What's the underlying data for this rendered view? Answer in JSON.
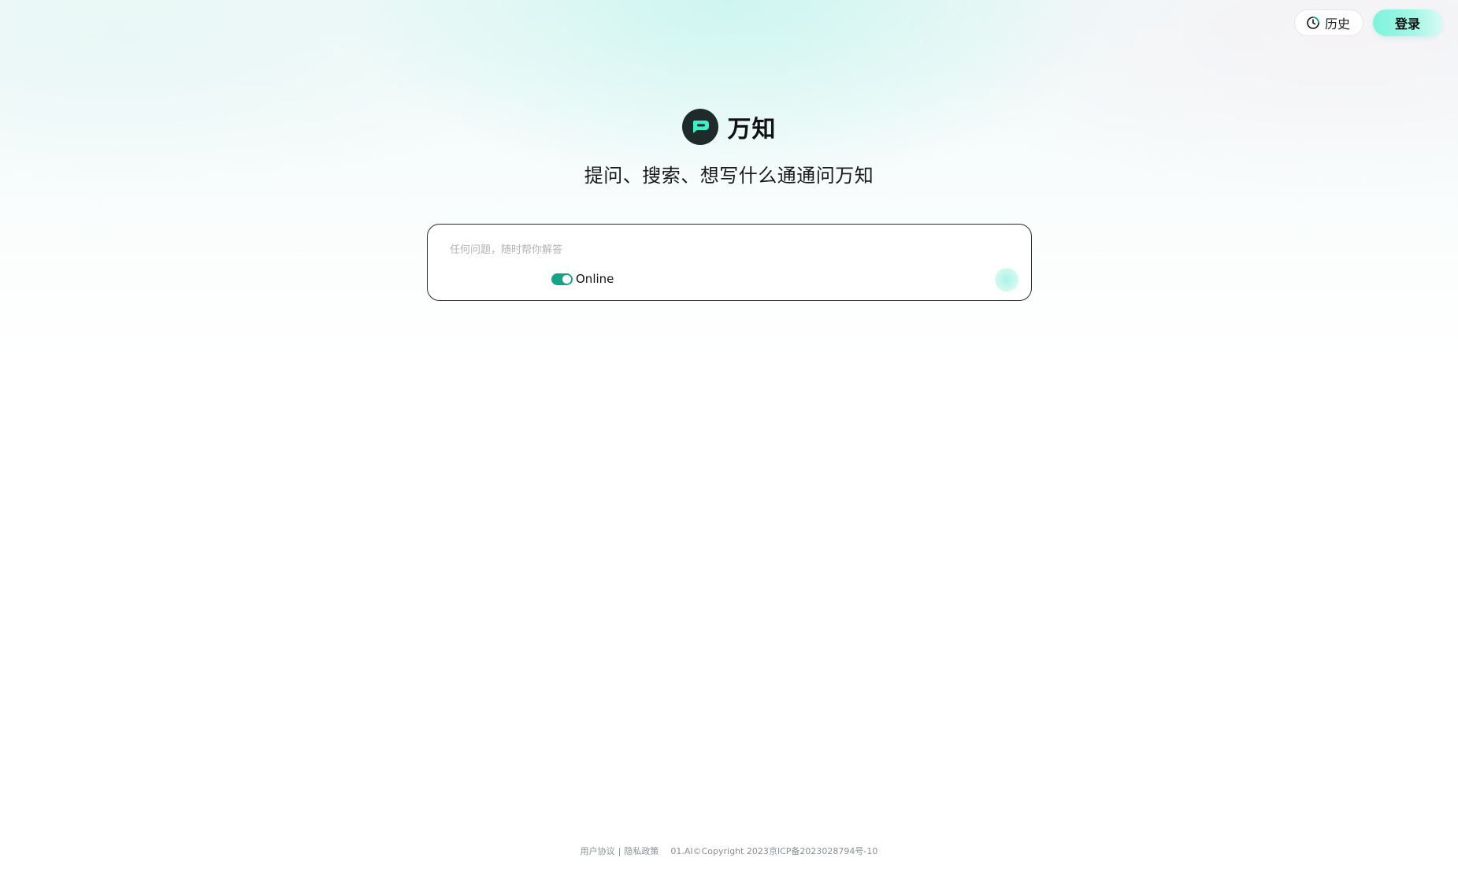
{
  "header": {
    "history_label": "历史",
    "history_icon": "clock-icon",
    "login_label": "登录"
  },
  "brand": {
    "name": "万知",
    "logo_icon": "chat-bubble-logo-icon",
    "tagline": "提问、搜索、想写什么通通问万知"
  },
  "search": {
    "placeholder": "任何问题，随时帮你解答",
    "value": "",
    "online_label": "Online",
    "online_enabled": true,
    "send_icon": "send-icon"
  },
  "footer": {
    "user_agreement": "用户协议",
    "separator": "|",
    "privacy_policy": "隐私政策",
    "copyright": "01.AI©Copyright 2023京ICP备2023028794号-10"
  },
  "colors": {
    "accent": "#15a38a",
    "login_gradient_start": "#7df3dc",
    "logo_bg": "#1f2a2a",
    "logo_mark": "#3ef0c6"
  }
}
